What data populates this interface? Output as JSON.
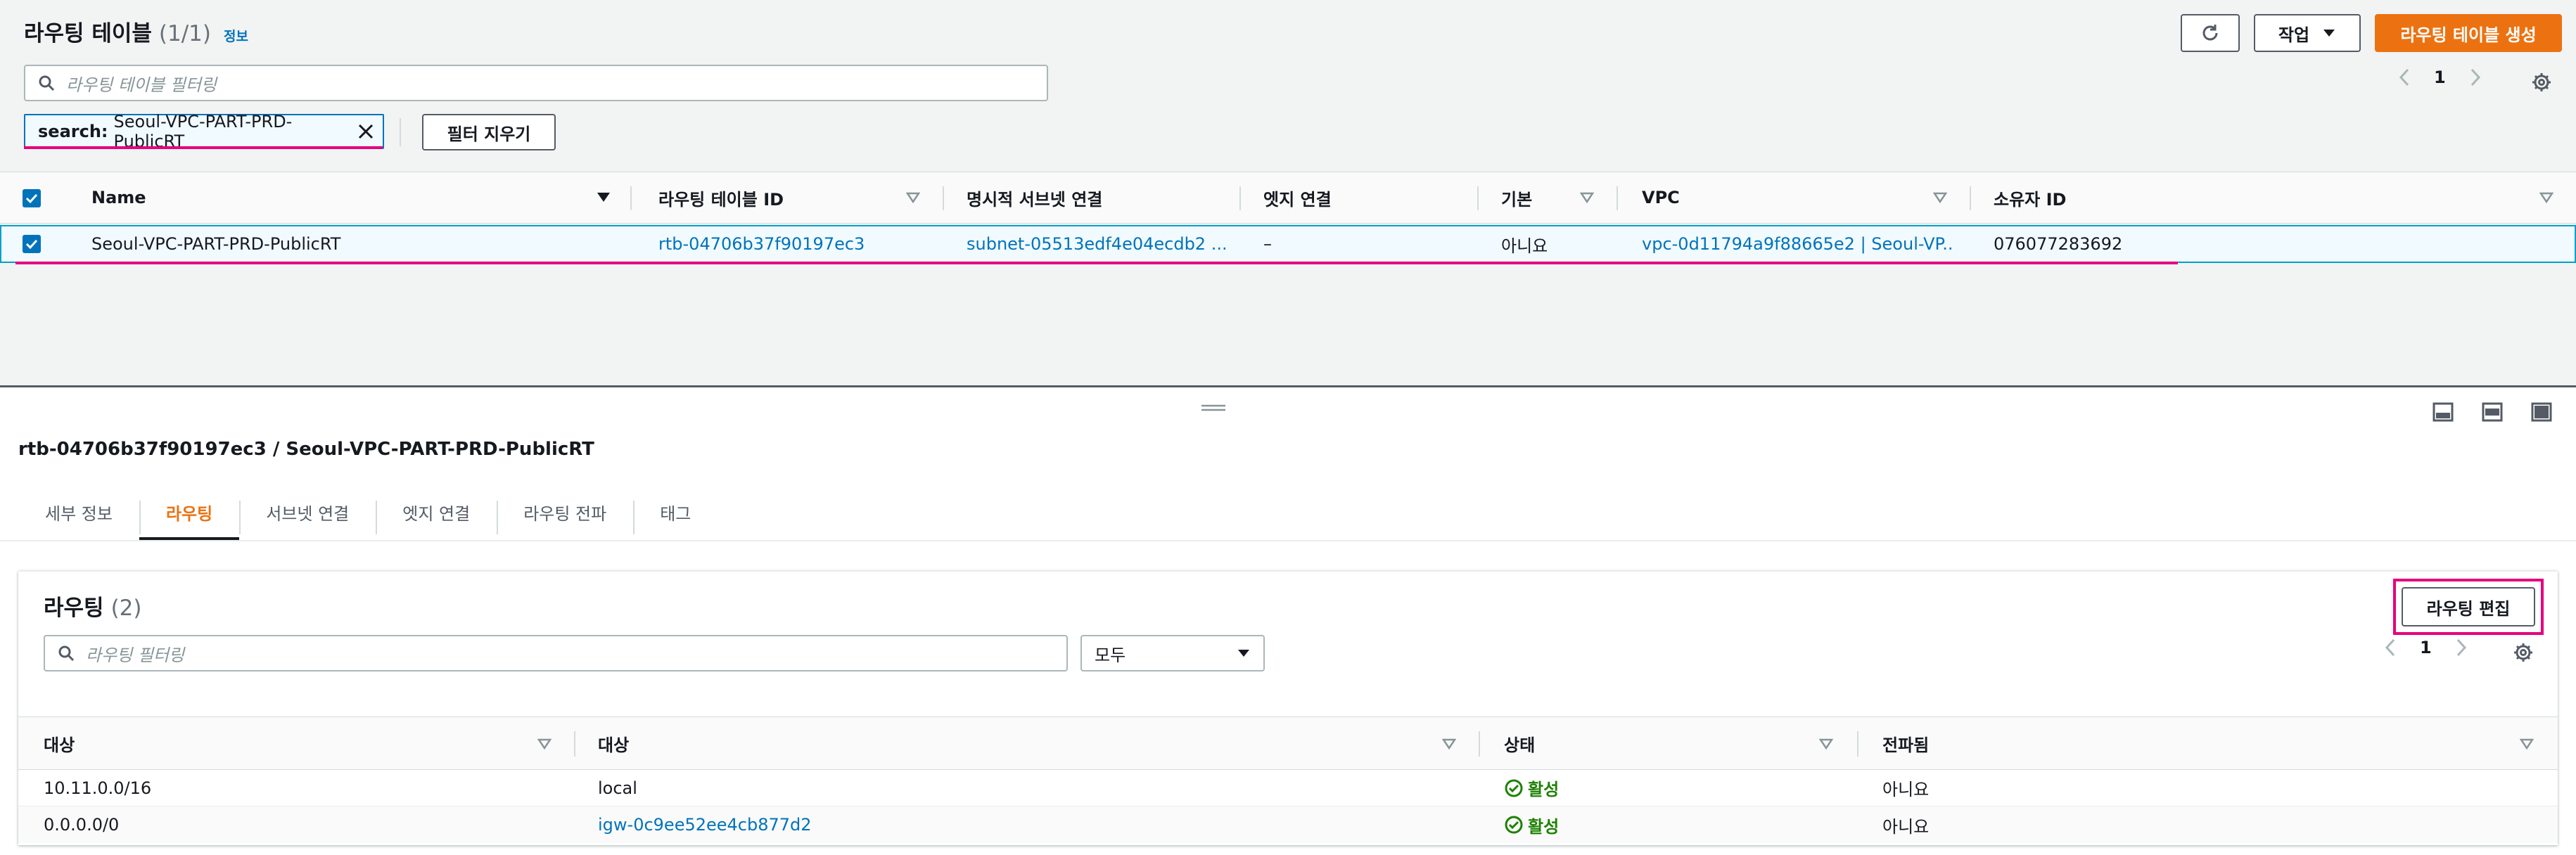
{
  "top_panel": {
    "title": "라우팅 테이블",
    "count": "(1/1)",
    "info": "정보",
    "actions_label": "작업",
    "create_label": "라우팅 테이블 생성",
    "filter_placeholder": "라우팅 테이블 필터링",
    "token_key": "search:",
    "token_value": "Seoul-VPC-PART-PRD-PublicRT",
    "clear_filter": "필터 지우기",
    "page": "1",
    "columns": [
      "Name",
      "라우팅 테이블 ID",
      "명시적 서브넷 연결",
      "엣지 연결",
      "기본",
      "VPC",
      "소유자 ID"
    ],
    "row": {
      "name": "Seoul-VPC-PART-PRD-PublicRT",
      "rtb_id": "rtb-04706b37f90197ec3",
      "subnet": "subnet-05513edf4e04ecdb2 ...",
      "edge": "–",
      "main": "아니요",
      "vpc": "vpc-0d11794a9f88665e2 | Seoul-VP...",
      "owner": "076077283692"
    }
  },
  "detail": {
    "title": "rtb-04706b37f90197ec3 / Seoul-VPC-PART-PRD-PublicRT",
    "tabs": [
      "세부 정보",
      "라우팅",
      "서브넷 연결",
      "엣지 연결",
      "라우팅 전파",
      "태그"
    ],
    "active_tab": 1
  },
  "routes": {
    "title": "라우팅",
    "count": "(2)",
    "edit_label": "라우팅 편집",
    "filter_placeholder": "라우팅 필터링",
    "select_value": "모두",
    "page": "1",
    "columns": [
      "대상",
      "대상",
      "상태",
      "전파됨"
    ],
    "rows": [
      {
        "destination": "10.11.0.0/16",
        "target": "local",
        "status": "활성",
        "propagated": "아니요"
      },
      {
        "destination": "0.0.0.0/0",
        "target": "igw-0c9ee52ee4cb877d2",
        "status": "활성",
        "propagated": "아니요"
      }
    ]
  },
  "colors": {
    "accent": "#ec7211",
    "link": "#0073bb",
    "success": "#1d8102",
    "highlight": "#e6007e"
  }
}
